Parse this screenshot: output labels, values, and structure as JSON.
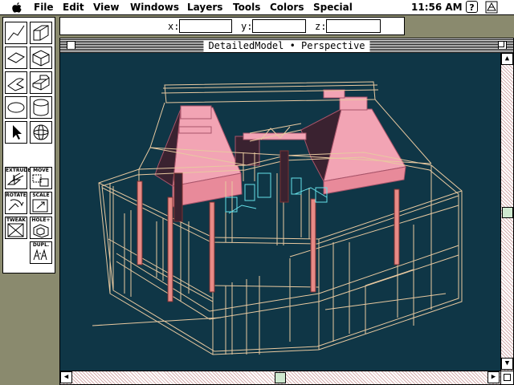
{
  "menubar": {
    "items": [
      "File",
      "Edit",
      "View",
      "Windows",
      "Layers",
      "Tools",
      "Colors",
      "Special"
    ],
    "clock": "11:56 AM",
    "help_icon": "?"
  },
  "coordbar": {
    "x_label": "x:",
    "y_label": "y:",
    "z_label": "z:",
    "x_value": "",
    "y_value": "",
    "z_value": ""
  },
  "toolbox": {
    "tools": [
      {
        "name": "line-tool-icon"
      },
      {
        "name": "wall-tool-icon"
      },
      {
        "name": "plane-tool-icon"
      },
      {
        "name": "box-tool-icon"
      },
      {
        "name": "polyline-tool-icon"
      },
      {
        "name": "extruded-shape-tool-icon"
      },
      {
        "name": "ellipse-tool-icon"
      },
      {
        "name": "cylinder-tool-icon"
      },
      {
        "name": "arrow-pointer-icon"
      },
      {
        "name": "sphere-tool-icon"
      }
    ],
    "captions": {
      "extrude": "EXTRUDE",
      "move": "MOVE",
      "rotate": "ROTATE",
      "scale": "SCALE",
      "tweak": "TWEAK",
      "hole": "HOLE+",
      "dupl": "DUPL."
    }
  },
  "document": {
    "title": "DetailedModel • Perspective",
    "viewport_bg": "#0f3646",
    "wire_color": "#e8c9a0",
    "post_color": "#e88a86",
    "roof_color": "#f2a4b4",
    "detail_color": "#66e0e8"
  }
}
